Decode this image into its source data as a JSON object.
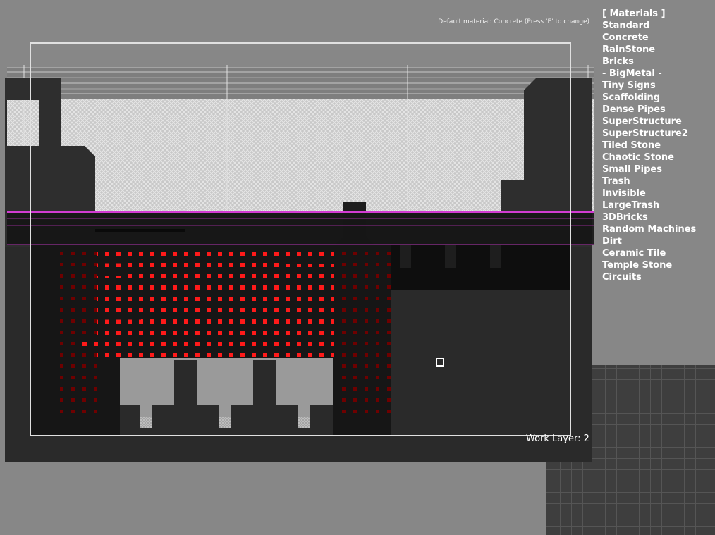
{
  "hint": "Default material: Concrete (Press 'E' to change)",
  "materials_title": "[ Materials ]",
  "materials": [
    "Standard",
    "Concrete",
    "RainStone",
    "Bricks",
    "- BigMetal -",
    "Tiny Signs",
    "Scaffolding",
    "Dense Pipes",
    "SuperStructure",
    "SuperStructure2",
    "Tiled Stone",
    "Chaotic Stone",
    "Small Pipes",
    "Trash",
    "Invisible",
    "LargeTrash",
    "3DBricks",
    "Random Machines",
    "Dirt",
    "Ceramic Tile",
    "Temple Stone",
    "Circuits"
  ],
  "work_layer": "Work Layer: 2",
  "colors": {
    "background": "#878787",
    "accent_red": "#ff1a1a",
    "dark_red": "#7a0000",
    "magenta_line": "#d23cd2",
    "camera_frame": "#e0e0e0"
  }
}
